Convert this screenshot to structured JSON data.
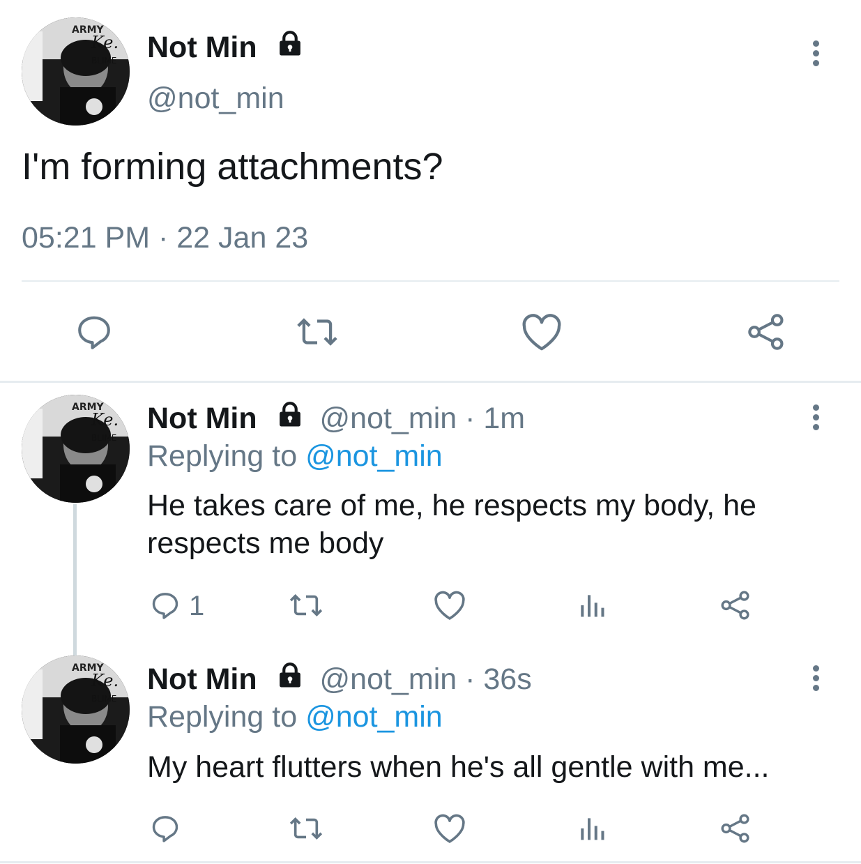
{
  "main_tweet": {
    "display_name": "Not Min",
    "handle": "@not_min",
    "text": "I'm forming attachments?",
    "timestamp": "05:21 PM · 22 Jan 23",
    "avatar_text": [
      "ARMY",
      "Ke.",
      "BLIME"
    ]
  },
  "actions_main": [
    "reply-icon",
    "retweet-icon",
    "like-icon",
    "share-icon"
  ],
  "replies": [
    {
      "display_name": "Not Min",
      "handle_time": "@not_min · 1m",
      "replying_prefix": "Replying to",
      "replying_to": "@not_min",
      "text_line1": "He takes care of me, he respects my body, he",
      "text_line2": "respects me body",
      "reply_count": "1"
    },
    {
      "display_name": "Not Min",
      "handle_time": "@not_min · 36s",
      "replying_prefix": "Replying to",
      "replying_to": "@not_min",
      "text_line1": "My heart flutters when he's all gentle with me...",
      "reply_count": ""
    }
  ],
  "colors": {
    "text": "#14171a",
    "muted": "#657786",
    "link": "#1b95e0",
    "divider": "#e6ecf0"
  }
}
